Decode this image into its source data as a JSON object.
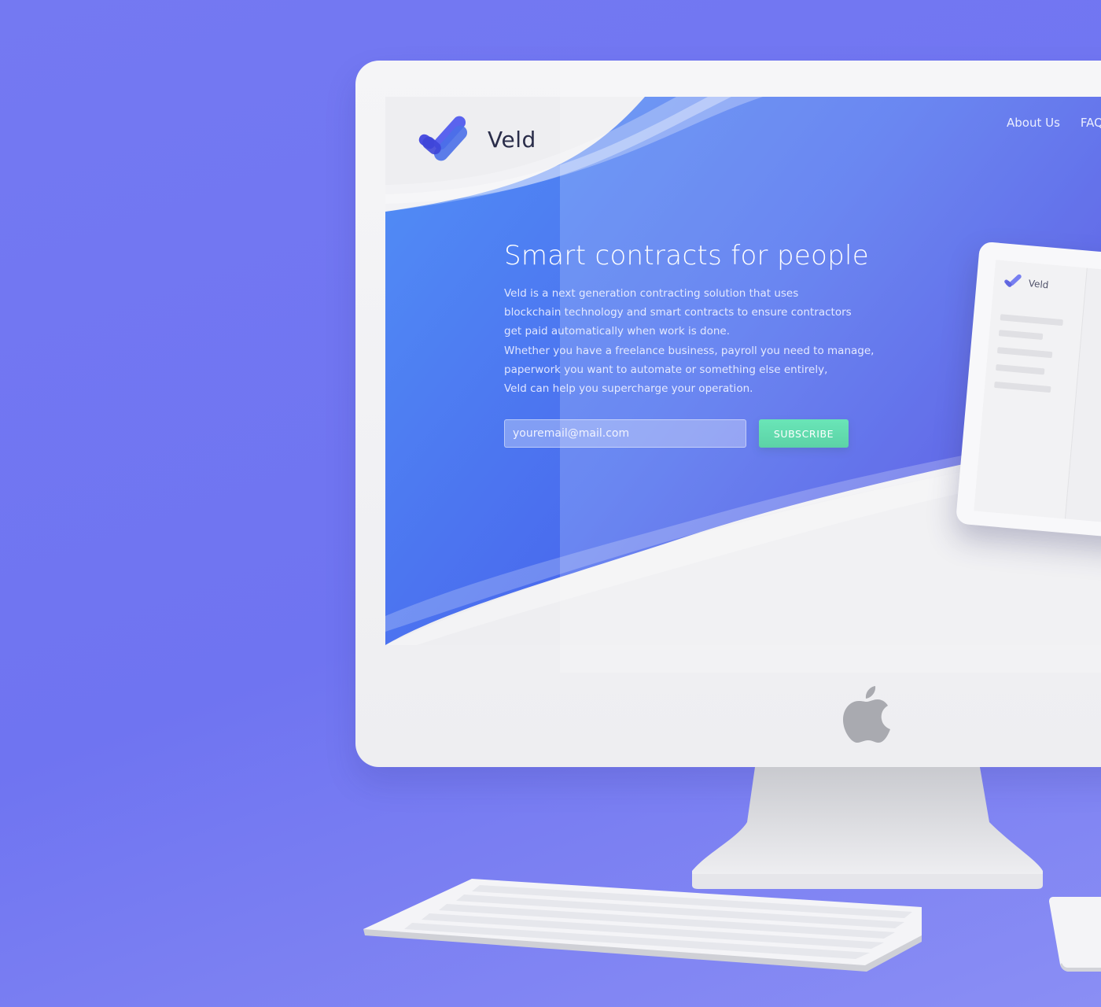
{
  "site": {
    "brand_name": "Veld",
    "nav": [
      "About Us",
      "FAQ"
    ],
    "hero": {
      "title": "Smart contracts for people",
      "paragraph_lines": [
        "Veld is a next generation contracting solution that uses",
        "blockchain technology and smart contracts to ensure contractors",
        "get paid automatically when work is done.",
        "Whether you have a freelance business, payroll you need to manage,",
        "paperwork you want to automate or something else entirely,",
        "Veld can help you supercharge your operation."
      ]
    },
    "subscribe_form": {
      "email_placeholder": "youremail@mail.com",
      "button_label": "SUBSCRIBE"
    },
    "tablet_preview": {
      "brand_name": "Veld"
    }
  },
  "colors": {
    "background": "#7479f2",
    "hero_gradient_start": "#5090f5",
    "hero_gradient_end": "#3e45e2",
    "button_green": "#45d9a2",
    "monitor_body": "#f2f2f4"
  },
  "icons": [
    "veld-logo-icon",
    "apple-logo-icon"
  ]
}
